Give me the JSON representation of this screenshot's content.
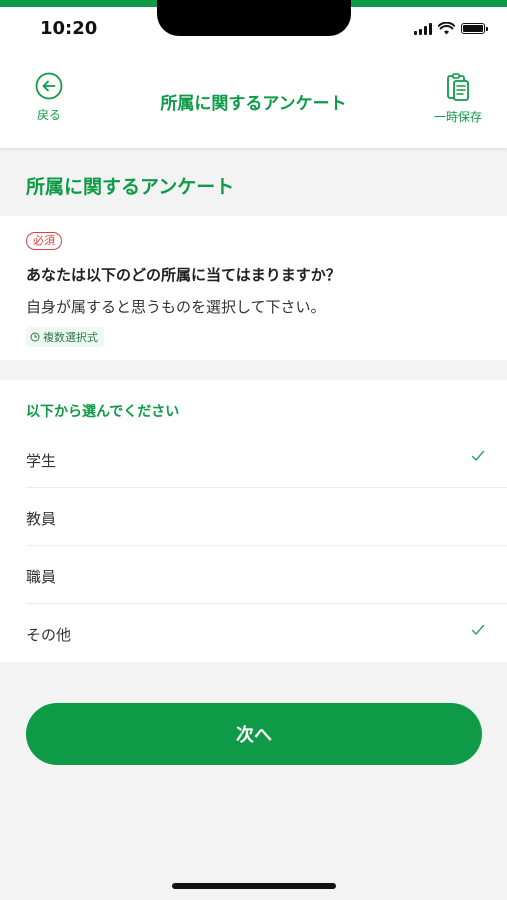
{
  "status_bar": {
    "time": "10:20"
  },
  "header": {
    "title": "所属に関するアンケート",
    "back_label": "戻る",
    "save_label": "一時保存"
  },
  "section": {
    "title": "所属に関するアンケート"
  },
  "question": {
    "required_badge": "必須",
    "text": "あなたは以下のどの所属に当てはまりますか？",
    "sub_text": "自身が属すると思うものを選択して下さい。",
    "type_tag": "複数選択式"
  },
  "options": {
    "header": "以下から選んでください",
    "items": [
      {
        "label": "学生",
        "checked": true
      },
      {
        "label": "教員",
        "checked": false
      },
      {
        "label": "職員",
        "checked": false
      },
      {
        "label": "その他",
        "checked": true
      }
    ]
  },
  "footer": {
    "next_label": "次へ"
  },
  "colors": {
    "accent": "#0f9a47",
    "required": "#e04040",
    "background": "#f3f3f3"
  },
  "icons": {
    "back": "back-arrow-circle-icon",
    "save": "clipboard-icon",
    "check": "check-icon",
    "clock": "clock-icon"
  }
}
